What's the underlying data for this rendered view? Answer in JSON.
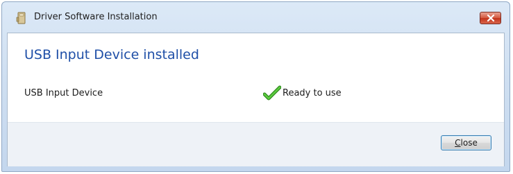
{
  "window": {
    "title": "Driver Software Installation",
    "title_icon": "driver-installer-icon",
    "close_icon": "close-icon"
  },
  "main": {
    "heading": "USB Input Device installed",
    "device": {
      "name": "USB Input Device",
      "status": "Ready to use",
      "status_icon": "green-checkmark-icon"
    }
  },
  "footer": {
    "close_button": {
      "accelerator": "C",
      "rest": "lose"
    }
  },
  "colors": {
    "heading": "#1f4fa7",
    "checkmark": "#3fae2a",
    "close_x_bg": "#c2331b"
  }
}
